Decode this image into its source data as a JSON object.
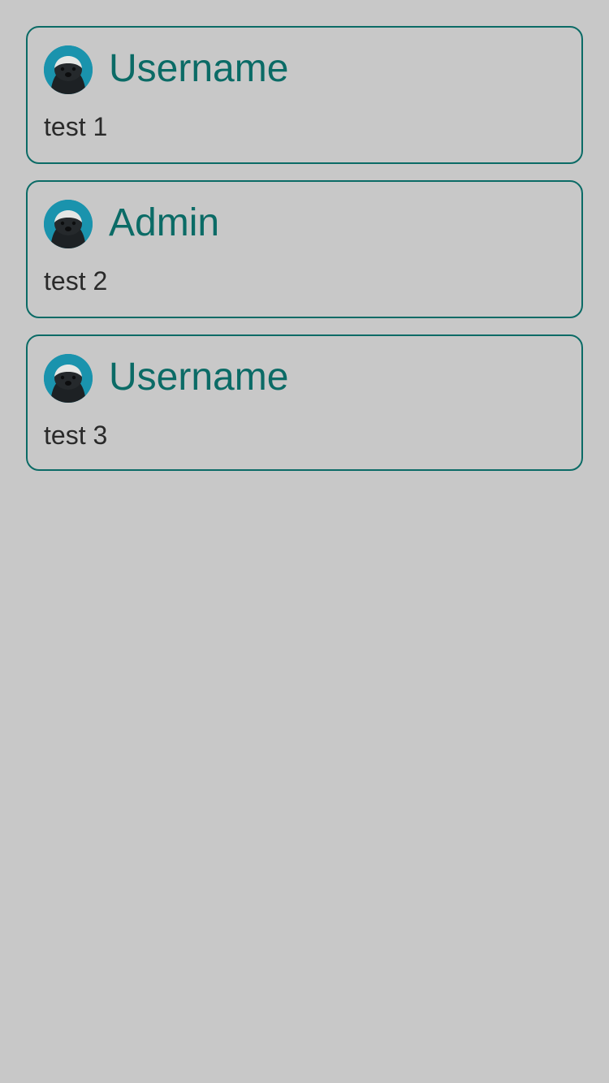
{
  "colors": {
    "background": "#c8c8c8",
    "accent": "#0b6b66",
    "text": "#2a2a2a",
    "avatar_bg": "#1a93ad"
  },
  "posts": [
    {
      "username": "Username",
      "message": "test 1",
      "avatar_icon": "honey-badger-avatar"
    },
    {
      "username": "Admin",
      "message": "test 2",
      "avatar_icon": "honey-badger-avatar"
    },
    {
      "username": "Username",
      "message": "test 3",
      "avatar_icon": "honey-badger-avatar"
    }
  ]
}
